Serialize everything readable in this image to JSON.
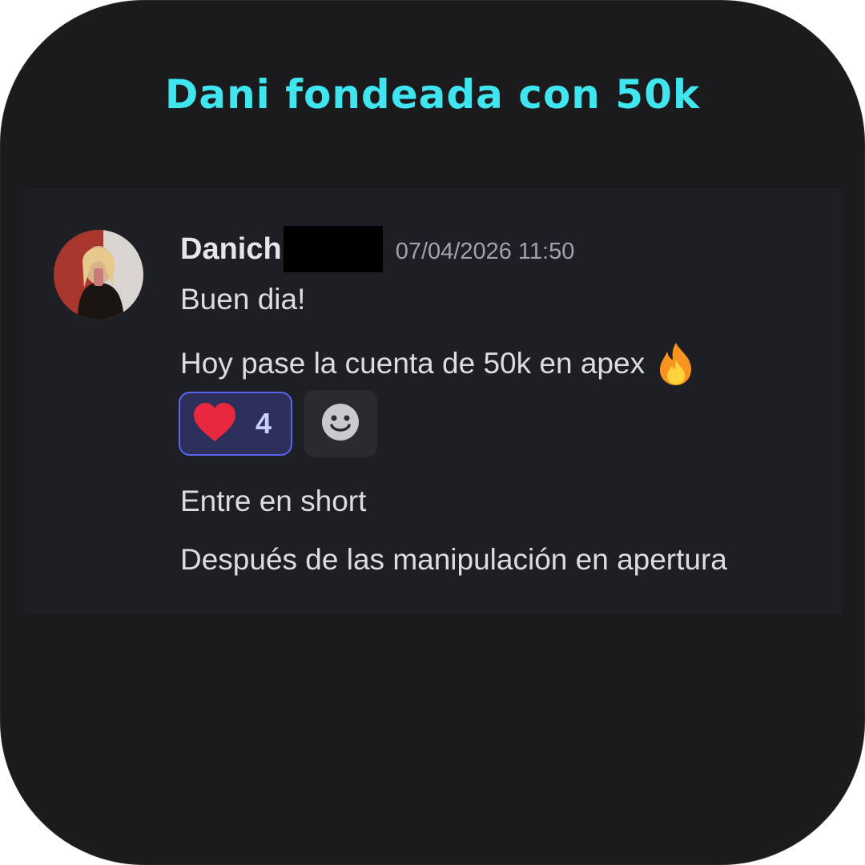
{
  "headline": "Dani fondeada con 50k",
  "message": {
    "author": "Danich",
    "timestamp": "07/04/2026 11:50",
    "lines": [
      "Buen dia!",
      "Hoy pase la cuenta de 50k en apex",
      "Entre en short",
      "Después de las manipulación en apertura"
    ],
    "inline_emoji": "fire-icon",
    "reactions": [
      {
        "emoji": "heart-icon",
        "count": "4",
        "selected": true
      }
    ],
    "add_reaction_icon": "smiley-icon"
  },
  "colors": {
    "headline": "#3fe6ef",
    "background": "#1b1b1d",
    "panel": "#1e1f24",
    "reaction_border": "#5865f2"
  }
}
